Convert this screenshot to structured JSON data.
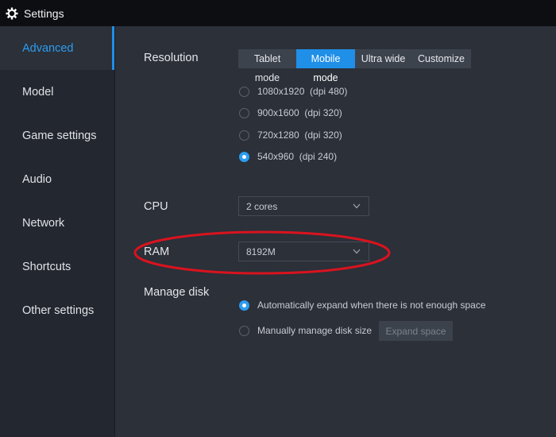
{
  "window": {
    "title": "Settings",
    "icon": "gear-icon"
  },
  "sidebar": {
    "items": [
      {
        "label": "Advanced",
        "active": true
      },
      {
        "label": "Model"
      },
      {
        "label": "Game settings"
      },
      {
        "label": "Audio"
      },
      {
        "label": "Network"
      },
      {
        "label": "Shortcuts"
      },
      {
        "label": "Other settings"
      }
    ]
  },
  "resolution": {
    "label": "Resolution",
    "modes": [
      "Tablet mode",
      "Mobile mode",
      "Ultra wide",
      "Customize"
    ],
    "selected_mode": "Mobile mode",
    "options": [
      "1080x1920  (dpi 480)",
      "900x1600  (dpi 320)",
      "720x1280  (dpi 320)",
      "540x960  (dpi 240)"
    ],
    "selected_option": "540x960  (dpi 240)"
  },
  "cpu": {
    "label": "CPU",
    "value": "2 cores"
  },
  "ram": {
    "label": "RAM",
    "value": "8192M"
  },
  "disk": {
    "label": "Manage disk",
    "options": [
      "Automatically expand when there is not enough space",
      "Manually manage disk size"
    ],
    "selected_option": "Automatically expand when there is not enough space",
    "expand_button": "Expand space"
  },
  "colors": {
    "accent": "#1f8fe8",
    "annotation": "#d9131e",
    "background": "#2b3039",
    "titlebar": "#0c0e12"
  }
}
